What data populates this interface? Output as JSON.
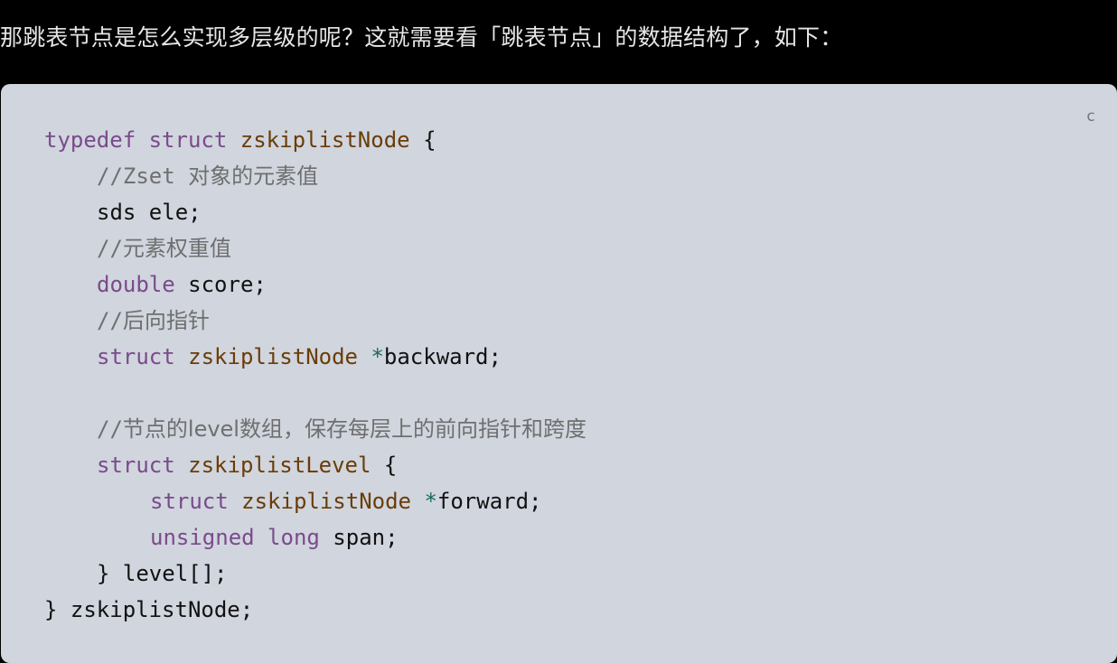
{
  "intro_text": "那跳表节点是怎么实现多层级的呢？这就需要看「跳表节点」的数据结构了，如下：",
  "copy_button_label": "c",
  "code": {
    "line1": {
      "kw": "typedef",
      "kw2": "struct",
      "type": "zskiplistNode",
      "rest": "{"
    },
    "line2": {
      "comment_prefix": "//Zset",
      "comment_text": "对象的元素值"
    },
    "line3": {
      "text": "sds ele;"
    },
    "line4": {
      "comment_prefix": "//",
      "comment_text": "元素权重值"
    },
    "line5": {
      "kw": "double",
      "rest": "score;"
    },
    "line6": {
      "comment_prefix": "//",
      "comment_text": "后向指针"
    },
    "line7": {
      "kw": "struct",
      "type": "zskiplistNode",
      "op": "*",
      "rest": "backward;"
    },
    "line9": {
      "comment_prefix": "//",
      "comment_text": "节点的level数组，保存每层上的前向指针和跨度"
    },
    "line10": {
      "kw": "struct",
      "type": "zskiplistLevel",
      "rest": "{"
    },
    "line11": {
      "kw": "struct",
      "type": "zskiplistNode",
      "op": "*",
      "rest": "forward;"
    },
    "line12": {
      "kw": "unsigned",
      "kw2": "long",
      "rest": "span;"
    },
    "line13": {
      "text": "} level[];"
    },
    "line14": {
      "text": "} zskiplistNode;"
    }
  }
}
